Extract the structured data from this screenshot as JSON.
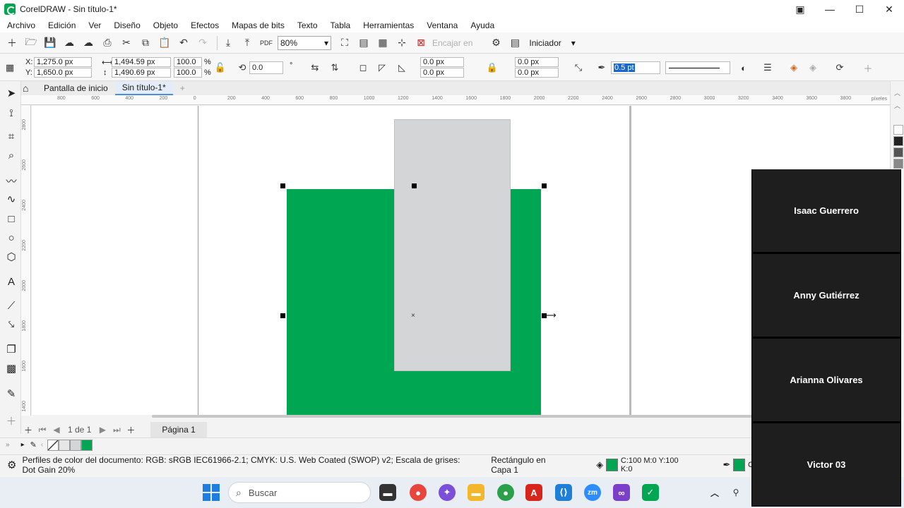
{
  "window": {
    "title": "CorelDRAW - Sin título-1*",
    "controls": [
      "▣",
      "—",
      "☐",
      "✕"
    ]
  },
  "menu": [
    "Archivo",
    "Edición",
    "Ver",
    "Diseño",
    "Objeto",
    "Efectos",
    "Mapas de bits",
    "Texto",
    "Tabla",
    "Herramientas",
    "Ventana",
    "Ayuda"
  ],
  "toolbar": {
    "zoom": "80%",
    "snap_label": "Encajar en",
    "launcher_label": "Iniciador"
  },
  "property_bar": {
    "x": "1,275.0 px",
    "y": "1,650.0 px",
    "width": "1,494.59 px",
    "height": "1,490.69 px",
    "scale_w": "100.0",
    "scale_h": "100.0",
    "percent": "%",
    "x_label": "X:",
    "y_label": "Y:",
    "rotation": "0.0",
    "degree": "°",
    "corner_1": "0.0 px",
    "corner_2": "0.0 px",
    "corner_3": "0.0 px",
    "corner_4": "0.0 px",
    "outline_width": "0.5 pt"
  },
  "tabs": {
    "home": "Pantalla de inicio",
    "document": "Sin título-1*",
    "add": "+"
  },
  "ruler": {
    "unit": "píxeles",
    "h_ticks": [
      "800",
      "600",
      "400",
      "200",
      "0",
      "200",
      "400",
      "600",
      "800",
      "1000",
      "1200",
      "1400",
      "1600",
      "1800",
      "2000",
      "2200",
      "2400",
      "2600",
      "2800",
      "3000",
      "3200",
      "3400",
      "3600",
      "3800"
    ],
    "v_ticks": [
      "2800",
      "2600",
      "2400",
      "2200",
      "2000",
      "1800",
      "1600",
      "1400"
    ]
  },
  "page_nav": {
    "counter": "1 de 1",
    "page_tab": "Página 1"
  },
  "status": {
    "color_profiles": "Perfiles de color del documento: RGB: sRGB IEC61966-2.1; CMYK: U.S. Web Coated (SWOP) v2; Escala de grises: Dot Gain 20%",
    "selection": "Rectángulo en Capa 1",
    "fill_value": "C:100 M:0 Y:100 K:0",
    "outline_value": "C:"
  },
  "colors": {
    "fill_green": "#00a651",
    "gray_rect": "#d3d5d7"
  },
  "taskbar": {
    "search_placeholder": "Buscar"
  },
  "participants": [
    "Isaac Guerrero",
    "Anny Gutiérrez",
    "Arianna Olivares",
    "Victor 03"
  ]
}
